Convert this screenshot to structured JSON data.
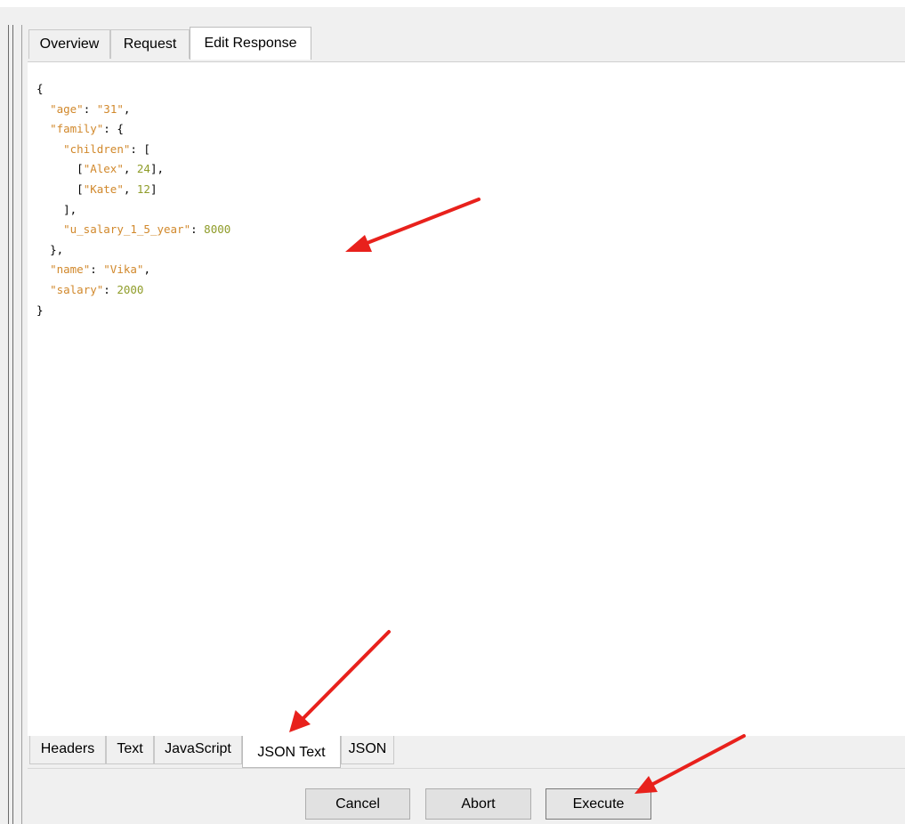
{
  "top_tabs": [
    {
      "label": "Overview"
    },
    {
      "label": "Request"
    },
    {
      "label": "Edit Response"
    }
  ],
  "json": {
    "age_key": "\"age\"",
    "age_val": "\"31\"",
    "family_key": "\"family\"",
    "children_key": "\"children\"",
    "child1_name": "\"Alex\"",
    "child1_age": "24",
    "child2_name": "\"Kate\"",
    "child2_age": "12",
    "salary15_key": "\"u_salary_1_5_year\"",
    "salary15_val": "8000",
    "name_key": "\"name\"",
    "name_val": "\"Vika\"",
    "salary_key": "\"salary\"",
    "salary_val": "2000"
  },
  "bottom_tabs": [
    {
      "label": "Headers"
    },
    {
      "label": "Text"
    },
    {
      "label": "JavaScript"
    },
    {
      "label": "JSON Text"
    },
    {
      "label": "JSON"
    }
  ],
  "buttons": {
    "cancel": "Cancel",
    "abort": "Abort",
    "execute": "Execute"
  },
  "colors": {
    "key": "#d1882b",
    "number": "#8f9c29",
    "annotation_arrow": "#e8211c"
  }
}
